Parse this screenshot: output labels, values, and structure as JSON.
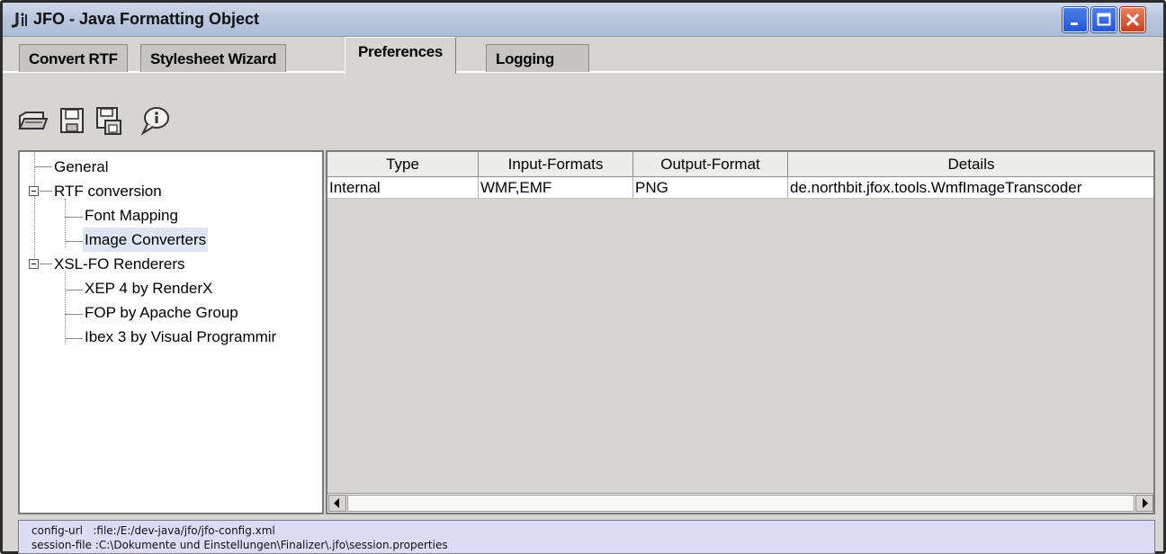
{
  "window": {
    "title": "JFO - Java Formatting Object",
    "icon": "jfo-app-icon"
  },
  "tabs": [
    {
      "label": "Convert RTF",
      "active": false
    },
    {
      "label": "Stylesheet Wizard",
      "active": false
    },
    {
      "label": "Preferences",
      "active": true
    },
    {
      "label": "Logging",
      "active": false
    }
  ],
  "toolbar": {
    "buttons": [
      {
        "name": "open-folder-icon"
      },
      {
        "name": "save-icon"
      },
      {
        "name": "save-as-icon"
      },
      {
        "name": "info-balloon-icon"
      }
    ]
  },
  "tree": {
    "items": [
      {
        "label": "General",
        "level": 0,
        "expander": false,
        "selected": false
      },
      {
        "label": "RTF conversion",
        "level": 0,
        "expander": true,
        "selected": false
      },
      {
        "label": "Font Mapping",
        "level": 1,
        "expander": false,
        "selected": false
      },
      {
        "label": "Image Converters",
        "level": 1,
        "expander": false,
        "selected": true
      },
      {
        "label": "XSL-FO Renderers",
        "level": 0,
        "expander": true,
        "selected": false
      },
      {
        "label": "XEP 4 by RenderX",
        "level": 1,
        "expander": false,
        "selected": false
      },
      {
        "label": "FOP by Apache Group",
        "level": 1,
        "expander": false,
        "selected": false
      },
      {
        "label": "Ibex 3 by Visual Programmir",
        "level": 1,
        "expander": false,
        "selected": false
      }
    ]
  },
  "table": {
    "columns": [
      "Type",
      "Input-Formats",
      "Output-Format",
      "Details"
    ],
    "rows": [
      [
        "Internal",
        "WMF,EMF",
        "PNG",
        "de.northbit.jfox.tools.WmfImageTranscoder"
      ]
    ]
  },
  "status": {
    "config_url": "config-url   :file:/E:/dev-java/jfo/jfo-config.xml",
    "session_file": "session-file :C:\\Dokumente und Einstellungen\\Finalizer\\.jfo\\session.properties"
  },
  "colors": {
    "selection": "#dde4f2",
    "status_background": "#dcdcf6",
    "close_button": "#c83f1e"
  }
}
